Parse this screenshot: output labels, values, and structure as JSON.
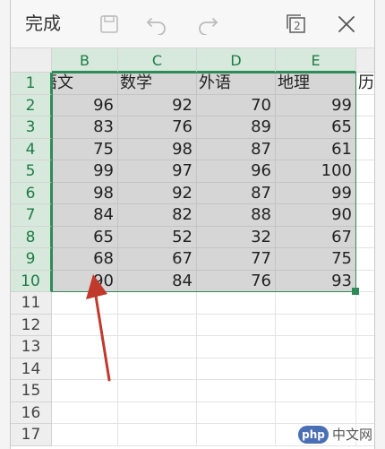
{
  "toolbar": {
    "done_label": "完成",
    "icons": [
      "save-icon",
      "undo-icon",
      "redo-icon",
      "sheet-count-icon",
      "close-icon"
    ],
    "sheet_count": "2"
  },
  "columns": [
    "B",
    "C",
    "D",
    "E"
  ],
  "row_numbers": [
    "1",
    "2",
    "3",
    "4",
    "5",
    "6",
    "7",
    "8",
    "9",
    "10",
    "11",
    "12",
    "13",
    "14",
    "15",
    "16",
    "17"
  ],
  "header_row": [
    "语文",
    "数学",
    "外语",
    "地理",
    "历"
  ],
  "rows": [
    [
      "96",
      "92",
      "70",
      "99"
    ],
    [
      "83",
      "76",
      "89",
      "65"
    ],
    [
      "75",
      "98",
      "87",
      "61"
    ],
    [
      "99",
      "97",
      "96",
      "100"
    ],
    [
      "98",
      "92",
      "87",
      "99"
    ],
    [
      "84",
      "82",
      "88",
      "90"
    ],
    [
      "65",
      "52",
      "32",
      "67"
    ],
    [
      "68",
      "67",
      "77",
      "75"
    ],
    [
      "90",
      "84",
      "76",
      "93"
    ]
  ],
  "colors": {
    "accent": "#2e8b57",
    "selection": "#d6d6d6",
    "arrow": "#c0392b"
  },
  "watermark": {
    "logo": "php",
    "text": "中文网"
  }
}
